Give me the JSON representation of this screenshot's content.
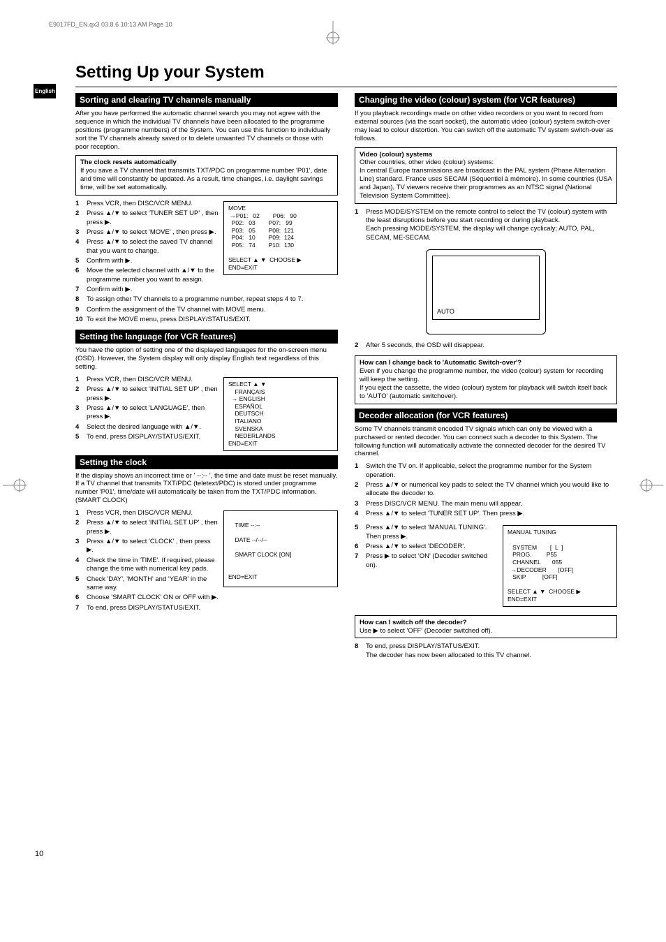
{
  "header_line": "E9017FD_EN.qx3  03.8.6  10:13 AM  Page 10",
  "lang_tab": "English",
  "main_title": "Setting Up your System",
  "page_number": "10",
  "left": {
    "sorting": {
      "heading": "Sorting and clearing TV channels manually",
      "intro": "After you have performed the automatic channel search you may not agree with the sequence in which the individual TV channels have been allocated to the programme positions (programme numbers) of the System. You can use this function to individually sort the TV channels already saved or to delete unwanted TV channels or those with poor reception.",
      "note_title": "The clock resets automatically",
      "note_body": "If you save a TV channel that transmits TXT/PDC on programme number 'P01', date and time will constantly be updated. As a result, time changes, i.e. daylight savings time, will be set automatically.",
      "steps": [
        "Press VCR, then DISC/VCR MENU.",
        "Press ▲/▼ to select 'TUNER SET UP' , then press ▶.",
        "Press ▲/▼ to select 'MOVE' , then press ▶.",
        "Press ▲/▼ to select the saved TV channel that you want to change.",
        "Confirm with ▶.",
        "Move the selected channel with ▲/▼ to the programme number you want to assign.",
        "Confirm with ▶.",
        "To assign other TV channels to a programme number, repeat steps 4 to 7.",
        "Confirm the assignment of the TV channel with MOVE menu.",
        "To exit the MOVE menu, press DISPLAY/STATUS/EXIT."
      ],
      "osd": "MOVE\n →P01:   02        P06:   90\n  P02:   03        P07:   99\n  P03:   05        P08:  121\n  P04:   10        P09:  124\n  P05:   74        P10:  130\n\nSELECT ▲ ▼  CHOOSE ▶\nEND=EXIT"
    },
    "language": {
      "heading": "Setting the language (for VCR features)",
      "intro": "You have the option of setting one of the displayed languages for the on-screen menu (OSD). However, the System display will only display English text regardless of this setting.",
      "steps": [
        "Press VCR, then DISC/VCR MENU.",
        "Press ▲/▼ to select 'INITIAL SET UP' , then press ▶.",
        "Press ▲/▼ to select 'LANGUAGE', then press ▶.",
        "Select the desired language with ▲/▼.",
        "To end, press DISPLAY/STATUS/EXIT."
      ],
      "osd": "SELECT ▲ ▼\n    FRANÇAIS\n  → ENGLISH\n    ESPAÑOL\n    DEUTSCH\n    ITALIANO\n    SVENSKA\n    NEDERLANDS\nEND=EXIT"
    },
    "clock": {
      "heading": "Setting the clock",
      "intro": "If the display shows an incorrect time or ' --:-- ', the time and date must be reset manually.\nIf a TV channel that transmits TXT/PDC (teletext/PDC) is stored under programme number 'P01', time/date will automatically be taken from the TXT/PDC information. (SMART CLOCK)",
      "steps": [
        "Press VCR, then DISC/VCR MENU.",
        "Press ▲/▼ to select 'INITIAL SET UP' , then press ▶.",
        "Press ▲/▼ to select 'CLOCK' , then press ▶.",
        "Check the time in 'TIME'. If required, please change the time with numerical key pads.",
        "Check 'DAY', 'MONTH' and 'YEAR' in the same way.",
        "Choose 'SMART CLOCK' ON or OFF with ▶.",
        "To end, press DISPLAY/STATUS/EXIT."
      ],
      "osd": "\n    TIME --:--\n\n    DATE --/--/--\n\n    SMART CLOCK [ON]\n\n\nEND=EXIT"
    }
  },
  "right": {
    "video": {
      "heading": "Changing the video (colour) system (for VCR features)",
      "intro": "If you playback recordings made on other video recorders or you want to record from external sources (via the scart socket), the automatic video (colour) system switch-over may lead to colour distortion.  You can switch off the automatic TV system switch-over as follows.",
      "note_title": "Video (colour) systems",
      "note_body": "Other countries, other video (colour) systems:\nIn central Europe transmissions are broadcast in the PAL system (Phase Alternation Line) standard. France uses SECAM (Séquentiel à mémoire). In some countries (USA and Japan), TV viewers receive their programmes as an NTSC signal (National Television System Committee).",
      "steps_a": [
        "Press MODE/SYSTEM on the remote control to select the TV (colour) system with the least disruptions before you start recording or during playback.\nEach pressing MODE/SYSTEM, the display will change cyclicaly; AUTO, PAL, SECAM, ME-SECAM."
      ],
      "tv_label": "AUTO",
      "steps_b": [
        "After 5 seconds, the OSD will disappear."
      ],
      "note2_title": "How can I change back to 'Automatic Switch-over'?",
      "note2_body": "Even if you change the programme number, the video (colour) system for recording will keep the setting.\nIf you eject the cassette, the video (colour) system for playback will switch itself back to 'AUTO' (automatic switchover)."
    },
    "decoder": {
      "heading": "Decoder allocation (for VCR features)",
      "intro": "Some TV channels transmit encoded TV signals which can only be viewed with a purchased or rented decoder. You can connect such a decoder to this System. The following function will automatically activate the connected decoder for the desired TV channel.",
      "steps_a": [
        "Switch the TV on. If applicable, select the programme number for the System operation.",
        "Press ▲/▼ or numerical key pads to select the TV channel which you would like to allocate the decoder to.",
        "Press DISC/VCR MENU. The main menu will appear.",
        "Press ▲/▼ to select 'TUNER SET UP'. Then press ▶."
      ],
      "steps_b": [
        "Press ▲/▼ to select 'MANUAL TUNING'. Then press ▶.",
        "Press ▲/▼ to select 'DECODER'.",
        "Press ▶ to select 'ON' (Decoder switched on)."
      ],
      "osd": "MANUAL TUNING\n\n   SYSTEM        [  L  ]\n   PROG.         P55\n   CHANNEL       055\n  →DECODER       [OFF]\n   SKIP          [OFF]\n\nSELECT ▲ ▼  CHOOSE ▶\nEND=EXIT",
      "note_title": "How can I switch off the decoder?",
      "note_body": "Use ▶ to select 'OFF' (Decoder switched off).",
      "steps_c": [
        "To end, press DISPLAY/STATUS/EXIT.\nThe decoder has now been allocated to this TV channel."
      ]
    }
  }
}
